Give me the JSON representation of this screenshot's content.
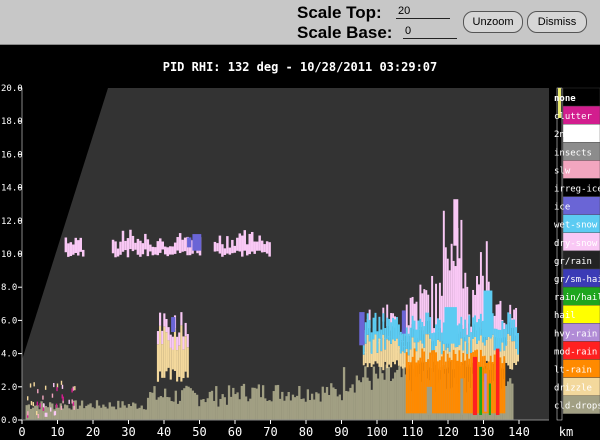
{
  "toolbar": {
    "scale_top_label": "Scale Top:",
    "scale_top_value": "20",
    "scale_base_label": "Scale Base:",
    "scale_base_value": "0",
    "unzoom_label": "Unzoom",
    "dismiss_label": "Dismiss"
  },
  "plot": {
    "title": "PID  RHI: 132 deg  -  10/28/2011 03:29:07",
    "x_unit": "km",
    "x_ticks": [
      "0",
      "10",
      "20",
      "30",
      "40",
      "50",
      "60",
      "70",
      "80",
      "90",
      "100",
      "110",
      "120",
      "130",
      "140"
    ],
    "y_ticks": [
      "0.0",
      "2.0",
      "4.0",
      "6.0",
      "8.0",
      "10.0",
      "12.0",
      "14.0",
      "16.0",
      "18.0",
      "20.0"
    ],
    "x_range": [
      0,
      150
    ],
    "y_range": [
      0,
      20
    ],
    "colors": {
      "background": "#333333",
      "blank": "#000000"
    }
  },
  "legend": {
    "items": [
      {
        "label": "none",
        "color": "#000000"
      },
      {
        "label": "clutter",
        "color": "#d21d8e"
      },
      {
        "label": "2nd-trip",
        "color": "#ffffff"
      },
      {
        "label": "insects",
        "color": "#8c8c8c"
      },
      {
        "label": "slw",
        "color": "#f2a6bf"
      },
      {
        "label": "irreg-ice",
        "color": "#000000"
      },
      {
        "label": "ice",
        "color": "#6a65d6"
      },
      {
        "label": "wet-snow",
        "color": "#5ccbf2"
      },
      {
        "label": "dry-snow",
        "color": "#f9c8f5"
      },
      {
        "label": "gr/rain",
        "color": "#232323"
      },
      {
        "label": "gr/sm-hail",
        "color": "#3b3bb6"
      },
      {
        "label": "rain/hail",
        "color": "#1ea51e"
      },
      {
        "label": "hail",
        "color": "#ffff00"
      },
      {
        "label": "hvy-rain",
        "color": "#b18bd6"
      },
      {
        "label": "mod-rain",
        "color": "#ff2020"
      },
      {
        "label": "lt-rain",
        "color": "#ff8a00"
      },
      {
        "label": "drizzle",
        "color": "#f3d89c"
      },
      {
        "label": "cld-drops",
        "color": "#a19f83"
      }
    ]
  }
}
